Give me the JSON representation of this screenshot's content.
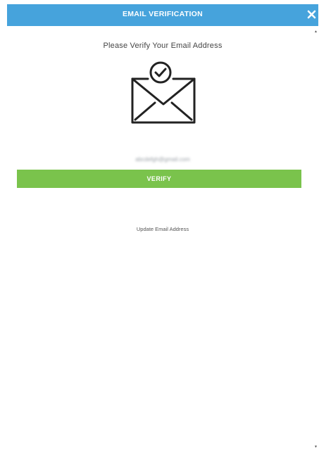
{
  "dialog": {
    "title": "EMAIL VERIFICATION",
    "close_icon": "close-icon",
    "prompt": "Please Verify Your Email Address",
    "illustration_icon": "envelope-check-icon",
    "email_value": "abcdefgh@gmail.com",
    "verify_label": "VERIFY",
    "update_link": "Update Email Address"
  },
  "scrollbar": {
    "up_icon": "scroll-up-arrow-icon",
    "down_icon": "scroll-down-arrow-icon"
  },
  "colors": {
    "header": "#46a3dc",
    "verify_button": "#7ac34c",
    "text": "#444444"
  }
}
